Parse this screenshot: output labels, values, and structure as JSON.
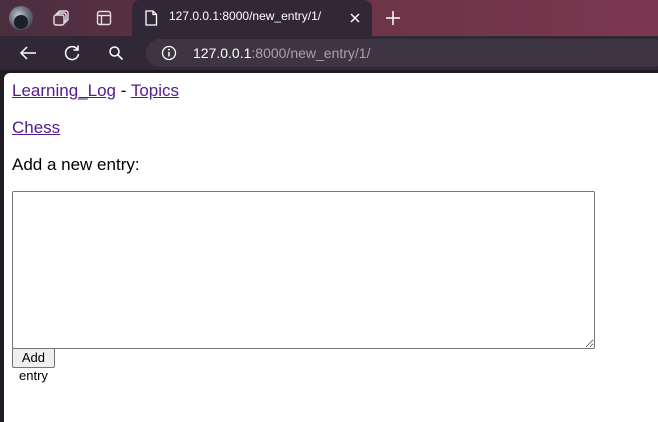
{
  "browser": {
    "tab": {
      "title": "127.0.0.1:8000/new_entry/1/"
    },
    "address_bar": {
      "host": "127.0.0.1",
      "rest": ":8000/new_entry/1/"
    },
    "icons": {
      "profile": "avatar",
      "workspaces": "workspaces-icon",
      "tab_actions": "tab-actions-icon",
      "favicon": "page-icon",
      "close": "close-icon",
      "new_tab": "plus-icon",
      "back": "back-arrow-icon",
      "reload": "reload-icon",
      "search": "search-icon",
      "site_info": "info-icon"
    },
    "colors": {
      "tabstrip": "#6a3345",
      "toolbar": "#302836",
      "omnibox": "#3e3543"
    }
  },
  "page": {
    "nav": {
      "home_link": "Learning_Log",
      "separator": "-",
      "topics_link": "Topics"
    },
    "topic_link": "Chess",
    "form": {
      "heading": "Add a new entry:",
      "text_value": "",
      "submit_label": "Add entry"
    },
    "colors": {
      "link": "#551a8b"
    }
  }
}
